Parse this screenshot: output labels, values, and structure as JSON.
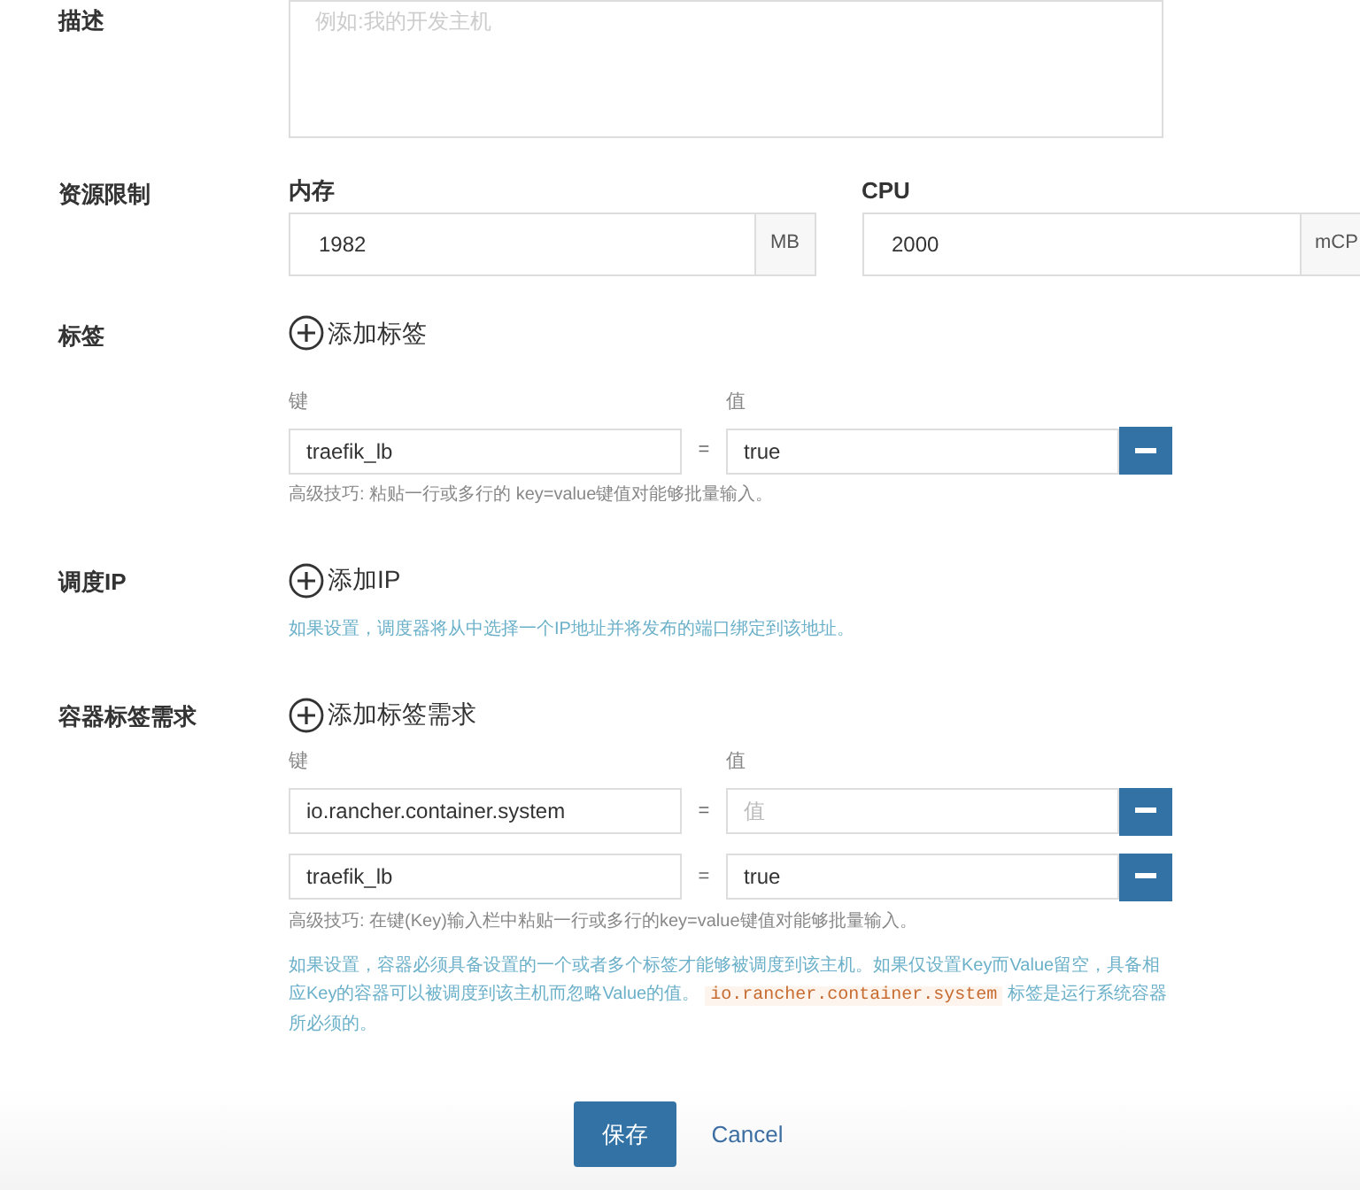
{
  "description": {
    "label": "描述",
    "placeholder": "例如:我的开发主机"
  },
  "resources": {
    "label": "资源限制",
    "fields": [
      {
        "label": "内存",
        "value": "1982",
        "unit": "MB"
      },
      {
        "label": "CPU",
        "value": "2000",
        "unit": "mCP"
      }
    ]
  },
  "labels": {
    "label": "标签",
    "add": "添加标签",
    "key_header": "键",
    "value_header": "值",
    "rows": [
      {
        "key": "traefik_lb",
        "eq": "=",
        "value": "true",
        "value_placeholder": ""
      }
    ],
    "tip": "高级技巧: 粘贴一行或多行的 key=value键值对能够批量输入。"
  },
  "scheduling_ip": {
    "label": "调度IP",
    "add": "添加IP",
    "help": "如果设置，调度器将从中选择一个IP地址并将发布的端口绑定到该地址。"
  },
  "container_labels": {
    "label": "容器标签需求",
    "add": "添加标签需求",
    "key_header": "键",
    "value_header": "值",
    "rows": [
      {
        "key": "io.rancher.container.system",
        "eq": "=",
        "value": "",
        "value_placeholder": "值"
      },
      {
        "key": "traefik_lb",
        "eq": "=",
        "value": "true",
        "value_placeholder": ""
      }
    ],
    "tip": "高级技巧: 在键(Key)输入栏中粘贴一行或多行的key=value键值对能够批量输入。",
    "help_before": "如果设置，容器必须具备设置的一个或者多个标签才能够被调度到该主机。如果仅设置Key而Value留空，具备相应Key的容器可以被调度到该主机而忽略Value的值。",
    "help_code": "io.rancher.container.system",
    "help_after": "标签是运行系统容器所必须的。"
  },
  "buttons": {
    "save": "保存",
    "cancel": "Cancel"
  }
}
